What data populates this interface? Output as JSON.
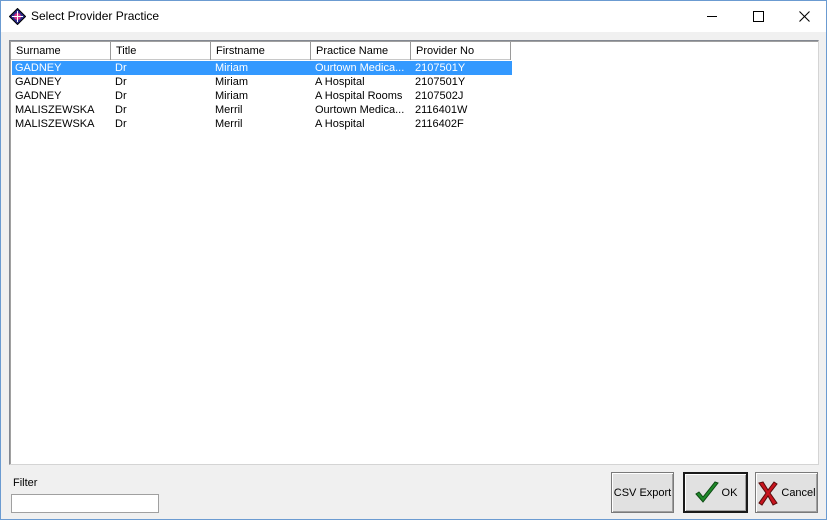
{
  "window": {
    "title": "Select Provider Practice"
  },
  "list": {
    "columns": [
      "Surname",
      "Title",
      "Firstname",
      "Practice Name",
      "Provider No"
    ],
    "rows": [
      {
        "surname": "GADNEY",
        "title": "Dr",
        "firstname": "Miriam",
        "practice": "Ourtown Medica...",
        "provider_no": "2107501Y",
        "selected": true
      },
      {
        "surname": "GADNEY",
        "title": "Dr",
        "firstname": "Miriam",
        "practice": "A Hospital",
        "provider_no": "2107501Y",
        "selected": false
      },
      {
        "surname": "GADNEY",
        "title": "Dr",
        "firstname": "Miriam",
        "practice": "A Hospital Rooms",
        "provider_no": "2107502J",
        "selected": false
      },
      {
        "surname": "MALISZEWSKA",
        "title": "Dr",
        "firstname": "Merril",
        "practice": "Ourtown Medica...",
        "provider_no": "2116401W",
        "selected": false
      },
      {
        "surname": "MALISZEWSKA",
        "title": "Dr",
        "firstname": "Merril",
        "practice": "A Hospital",
        "provider_no": "2116402F",
        "selected": false
      }
    ]
  },
  "filter": {
    "label": "Filter",
    "value": ""
  },
  "buttons": {
    "csv_export": "CSV Export",
    "ok": "OK",
    "cancel": "Cancel"
  },
  "icons": {
    "app": "app-diamond-icon",
    "minimize": "minimize-icon",
    "maximize": "maximize-icon",
    "close": "close-icon",
    "ok": "checkmark-icon",
    "cancel": "red-x-icon"
  },
  "colors": {
    "selection": "#3399ff",
    "ok_check": "#1f8a2b",
    "cancel_x": "#c8141e"
  }
}
